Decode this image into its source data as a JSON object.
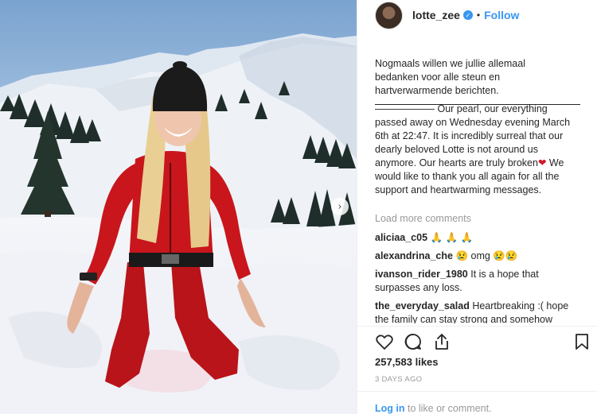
{
  "post": {
    "username": "lotte_zee",
    "follow_label": "Follow",
    "dot": "•",
    "verified_icon": "✓",
    "next_icon": "›",
    "caption_dutch": "Nogmaals willen we jullie allemaal\nbedanken voor alle steun en\nhartverwarmende berichten.",
    "caption_english": "—————— Our pearl, our everything passed away on Wednesday evening March 6th at 22:47. It is incredibly surreal that our dearly beloved Lotte is not around us anymore. Our hearts are truly broken",
    "caption_english_end": "We would like to thank you all again for all the support and heartwarming messages.",
    "heart_emoji": "❤"
  },
  "comments": {
    "load_more": "Load more comments",
    "items": [
      {
        "user": "aliciaa_c05",
        "text": "🙏 🙏 🙏"
      },
      {
        "user": "alexandrina_che",
        "text": "😢 omg 😢😢"
      },
      {
        "user": "ivanson_rider_1980",
        "text": "It is a hope that surpasses any loss."
      },
      {
        "user": "the_everyday_salad",
        "text": "Heartbreaking :( hope the family can stay strong and somehow"
      }
    ]
  },
  "engagement": {
    "likes": "257,583 likes",
    "time": "3 DAYS AGO"
  },
  "footer": {
    "login_link": "Log in",
    "login_rest": " to like or comment."
  },
  "colors": {
    "accent": "#3897f0",
    "muted": "#999999",
    "text": "#262626",
    "snowsuit": "#c8161c"
  },
  "icons": [
    "heart-icon",
    "comment-icon",
    "share-icon",
    "bookmark-icon",
    "verified-badge-icon",
    "chevron-right-icon"
  ]
}
